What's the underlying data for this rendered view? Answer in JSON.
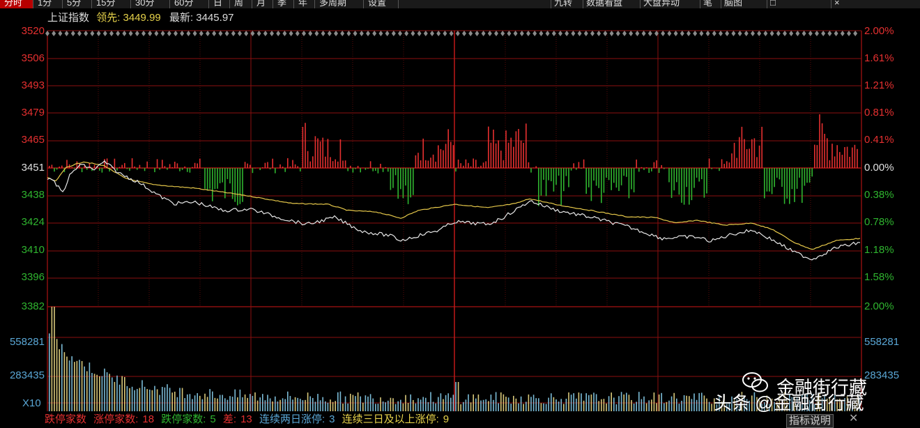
{
  "tabs": [
    "分时",
    "1分",
    "5分",
    "15分",
    "30分",
    "60分",
    "日",
    "周",
    "月",
    "季",
    "年",
    "多周期",
    "设置"
  ],
  "right_tabs": [
    "九转",
    "数据看盘",
    "大盘异动",
    "笔",
    "脑图",
    "□",
    "×"
  ],
  "header": {
    "index_name": "上证指数",
    "lead_label": "领先:",
    "lead_value": "3449.99",
    "latest_label": "最新:",
    "latest_value": "3445.97"
  },
  "left_axis": {
    "up": [
      "3520",
      "3506",
      "3493",
      "3479",
      "3465"
    ],
    "base": "3451",
    "down": [
      "3438",
      "3424",
      "3410",
      "3396",
      "3382"
    ]
  },
  "right_axis": {
    "up": [
      "2.00%",
      "1.61%",
      "1.21%",
      "0.81%",
      "0.41%"
    ],
    "base": "0.00%",
    "down": [
      "0.38%",
      "0.78%",
      "1.18%",
      "1.58%",
      "2.00%"
    ]
  },
  "volume_axis": {
    "left_top": "558281",
    "left_mid": "283435",
    "right_top": "558281",
    "right_mid": "283435",
    "multiplier": "X10"
  },
  "bottom_stats": {
    "limit_down_label": "跌停家数",
    "limit_up_label": "涨停家数:",
    "limit_up_value": "18",
    "limit_down2_label": "跌停家数:",
    "limit_down2_value": "5",
    "diff_label": "差:",
    "diff_value": "13",
    "two_day_label": "连续两日涨停:",
    "two_day_value": "3",
    "three_day_label": "连续三日及以上涨停:",
    "three_day_value": "9"
  },
  "help_button": "指标说明",
  "close_icon": "close-icon",
  "watermark": {
    "account": "金融街行藏",
    "line": "头条 @金融街行藏"
  },
  "colors": {
    "up": "#e63030",
    "down": "#2fb52f",
    "price_line": "#e8e8e8",
    "avg_line": "#e6c84a",
    "grid": "#8b0f0f",
    "volume": "#7bbbd6"
  }
}
